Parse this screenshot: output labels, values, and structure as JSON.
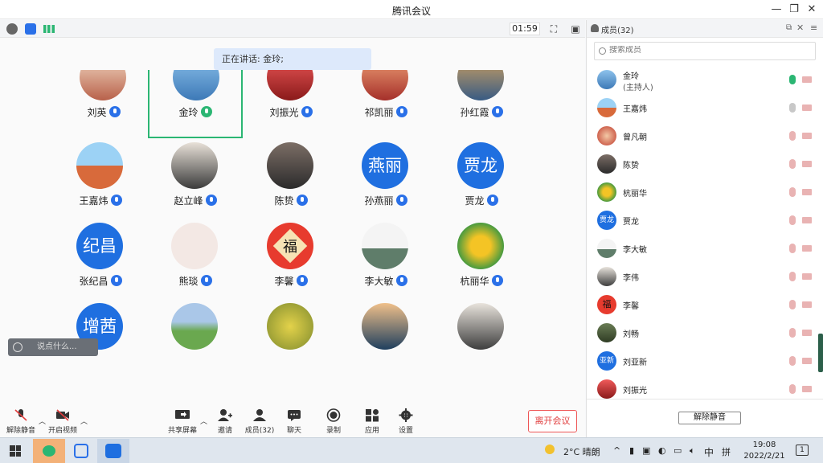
{
  "window": {
    "title": "腾讯会议"
  },
  "statusbar": {
    "timer": "01:59"
  },
  "speaking": {
    "text": "正在讲话: 金玲;"
  },
  "grid": {
    "row1": [
      "刘英",
      "金玲",
      "刘振光",
      "祁凯丽",
      "孙红霞"
    ],
    "row2": [
      "王嘉炜",
      "赵立峰",
      "陈贽",
      "孙燕丽",
      "贾龙"
    ],
    "row3": [
      "张纪昌",
      "熊琰",
      "李馨",
      "李大敏",
      "杭丽华"
    ],
    "row2_avatar_text": [
      "",
      "",
      "",
      "燕丽",
      "贾龙"
    ],
    "row3_avatar_text": [
      "纪昌",
      "",
      "",
      "",
      ""
    ],
    "row4_avatar_text": [
      "增茜",
      "",
      "",
      "",
      ""
    ],
    "featured_badge": "福"
  },
  "chat": {
    "placeholder": "说点什么..."
  },
  "toolbar": {
    "unmute": "解除静音",
    "start_video": "开启视频",
    "share": "共享屏幕",
    "invite": "邀请",
    "members": "成员(32)",
    "chat": "聊天",
    "record": "录制",
    "apps": "应用",
    "settings": "设置",
    "leave": "离开会议"
  },
  "panel": {
    "title": "成员(32)",
    "search_placeholder": "搜索成员",
    "members": [
      {
        "name": "金玲",
        "sub": "(主持人)",
        "avatar_text": ""
      },
      {
        "name": "王嘉炜",
        "sub": "",
        "avatar_text": ""
      },
      {
        "name": "曾凡朝",
        "sub": "",
        "avatar_text": ""
      },
      {
        "name": "陈贽",
        "sub": "",
        "avatar_text": ""
      },
      {
        "name": "杭丽华",
        "sub": "",
        "avatar_text": ""
      },
      {
        "name": "贾龙",
        "sub": "",
        "avatar_text": "贾龙"
      },
      {
        "name": "李大敏",
        "sub": "",
        "avatar_text": ""
      },
      {
        "name": "李伟",
        "sub": "",
        "avatar_text": ""
      },
      {
        "name": "李馨",
        "sub": "",
        "avatar_text": "福"
      },
      {
        "name": "刘畅",
        "sub": "",
        "avatar_text": ""
      },
      {
        "name": "刘亚新",
        "sub": "",
        "avatar_text": "亚新"
      },
      {
        "name": "刘振光",
        "sub": "",
        "avatar_text": ""
      }
    ],
    "unmute_all": "解除静音"
  },
  "taskbar": {
    "weather": "2°C 晴朗",
    "ime": "中",
    "ime2": "拼",
    "time": "19:08",
    "date": "2022/2/21",
    "notif_count": "1"
  },
  "colors": {
    "accent": "#1f6fe0",
    "active_border": "#2bb673",
    "leave": "#e03c3c"
  }
}
